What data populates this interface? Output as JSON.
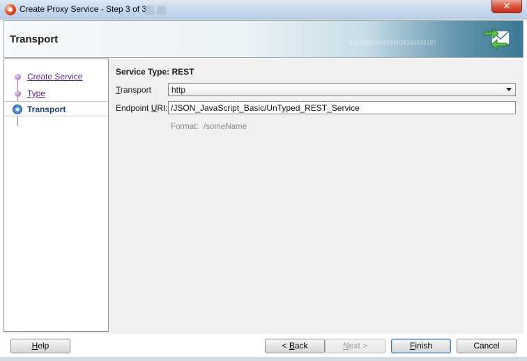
{
  "window": {
    "title": "Create Proxy Service - Step 3 of 3",
    "close_glyph": "✕"
  },
  "banner": {
    "title": "Transport",
    "binary_text": "01010101010101010101010101",
    "icon": "transport-envelope-icon"
  },
  "steps": [
    {
      "label": "Create Service",
      "state": "visited"
    },
    {
      "label": "Type",
      "state": "visited"
    },
    {
      "label": "Transport",
      "state": "current"
    }
  ],
  "form": {
    "service_type": "Service Type: REST",
    "transport_label_mn": "T",
    "transport_label_rest": "ransport",
    "transport_value": "http",
    "endpoint_label_pre": "Endpoint ",
    "endpoint_label_mn": "U",
    "endpoint_label_rest": "RI:",
    "endpoint_value": "/JSON_JavaScript_Basic/UnTyped_REST_Service",
    "format_label": "Format:",
    "format_value": "/someName"
  },
  "buttons": {
    "help": {
      "mn": "H",
      "rest": "elp"
    },
    "back": {
      "pre": "< ",
      "mn": "B",
      "rest": "ack"
    },
    "next": {
      "mn": "N",
      "rest": "ext >"
    },
    "finish": {
      "mn": "F",
      "rest": "inish"
    },
    "cancel": "Cancel"
  },
  "colors": {
    "visited_link": "#5b2a86",
    "current_step": "#1d3c6e",
    "close_button": "#c2301a"
  }
}
